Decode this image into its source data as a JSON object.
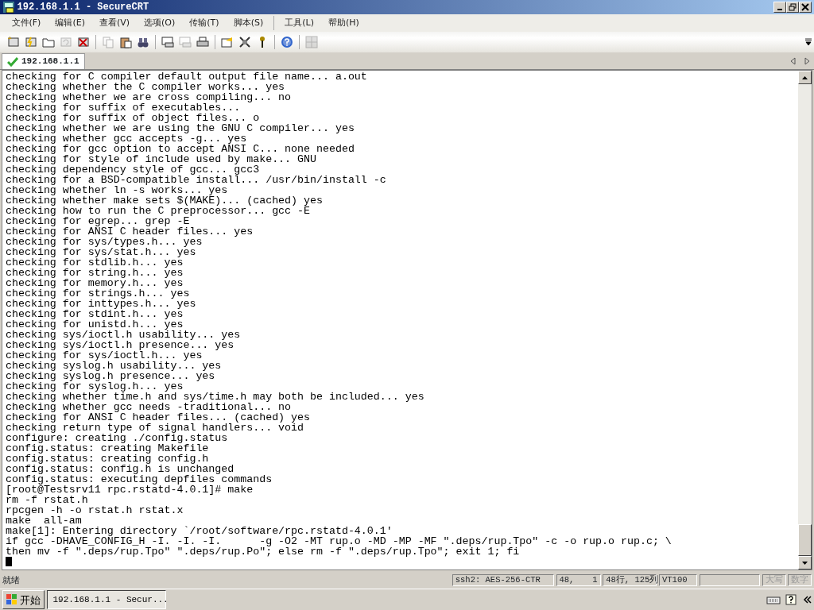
{
  "window": {
    "title": "192.168.1.1 - SecureCRT"
  },
  "menu": [
    "文件(F)",
    "编辑(E)",
    "查看(V)",
    "选项(O)",
    "传输(T)",
    "脚本(S)",
    "工具(L)",
    "帮助(H)"
  ],
  "toolbar": [
    {
      "kind": "connect",
      "disabled": false
    },
    {
      "kind": "quick-connect",
      "disabled": false
    },
    {
      "kind": "folder",
      "disabled": false
    },
    {
      "kind": "reconnect",
      "disabled": true
    },
    {
      "kind": "disconnect",
      "disabled": false
    },
    {
      "kind": "sep"
    },
    {
      "kind": "copy",
      "disabled": true
    },
    {
      "kind": "paste",
      "disabled": false
    },
    {
      "kind": "find",
      "disabled": false
    },
    {
      "kind": "sep"
    },
    {
      "kind": "print-screen",
      "disabled": false
    },
    {
      "kind": "print-selection",
      "disabled": true
    },
    {
      "kind": "print",
      "disabled": false
    },
    {
      "kind": "sep"
    },
    {
      "kind": "options",
      "disabled": false
    },
    {
      "kind": "session-options",
      "disabled": false
    },
    {
      "kind": "key",
      "disabled": false
    },
    {
      "kind": "sep"
    },
    {
      "kind": "help",
      "disabled": false
    },
    {
      "kind": "sep"
    },
    {
      "kind": "map",
      "disabled": true
    }
  ],
  "tabs": [
    {
      "label": "192.168.1.1",
      "selected": true,
      "connected": true
    }
  ],
  "terminal": {
    "lines": [
      "checking for C compiler default output file name... a.out",
      "checking whether the C compiler works... yes",
      "checking whether we are cross compiling... no",
      "checking for suffix of executables...",
      "checking for suffix of object files... o",
      "checking whether we are using the GNU C compiler... yes",
      "checking whether gcc accepts -g... yes",
      "checking for gcc option to accept ANSI C... none needed",
      "checking for style of include used by make... GNU",
      "checking dependency style of gcc... gcc3",
      "checking for a BSD-compatible install... /usr/bin/install -c",
      "checking whether ln -s works... yes",
      "checking whether make sets $(MAKE)... (cached) yes",
      "checking how to run the C preprocessor... gcc -E",
      "checking for egrep... grep -E",
      "checking for ANSI C header files... yes",
      "checking for sys/types.h... yes",
      "checking for sys/stat.h... yes",
      "checking for stdlib.h... yes",
      "checking for string.h... yes",
      "checking for memory.h... yes",
      "checking for strings.h... yes",
      "checking for inttypes.h... yes",
      "checking for stdint.h... yes",
      "checking for unistd.h... yes",
      "checking sys/ioctl.h usability... yes",
      "checking sys/ioctl.h presence... yes",
      "checking for sys/ioctl.h... yes",
      "checking syslog.h usability... yes",
      "checking syslog.h presence... yes",
      "checking for syslog.h... yes",
      "checking whether time.h and sys/time.h may both be included... yes",
      "checking whether gcc needs -traditional... no",
      "checking for ANSI C header files... (cached) yes",
      "checking return type of signal handlers... void",
      "configure: creating ./config.status",
      "config.status: creating Makefile",
      "config.status: creating config.h",
      "config.status: config.h is unchanged",
      "config.status: executing depfiles commands",
      "[root@Testsrv11 rpc.rstatd-4.0.1]# make",
      "rm -f rstat.h",
      "rpcgen -h -o rstat.h rstat.x",
      "make  all-am",
      "make[1]: Entering directory `/root/software/rpc.rstatd-4.0.1'",
      "if gcc -DHAVE_CONFIG_H -I. -I. -I.      -g -O2 -MT rup.o -MD -MP -MF \".deps/rup.Tpo\" -c -o rup.o rup.c; \\",
      "then mv -f \".deps/rup.Tpo\" \".deps/rup.Po\"; else rm -f \".deps/rup.Tpo\"; exit 1; fi"
    ],
    "cursor": true
  },
  "status_bar": {
    "message": "就绪",
    "cipher": "ssh2: AES-256-CTR",
    "position_row": "48,",
    "position_col": "1",
    "size": "48行, 125列",
    "emulation": "VT100",
    "caps": "大写",
    "num": "数字"
  },
  "taskbar": {
    "start": "开始",
    "window_button": "192.168.1.1 - Secur..."
  }
}
